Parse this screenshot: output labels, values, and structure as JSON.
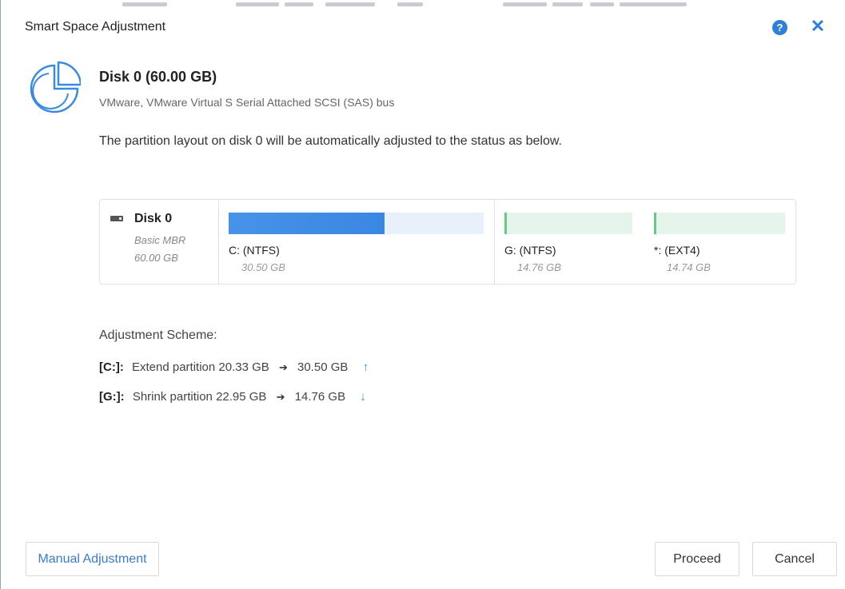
{
  "window": {
    "title": "Smart Space Adjustment",
    "help_icon": "help-icon",
    "close_icon": "close-icon"
  },
  "disk": {
    "icon": "pie-chart-icon",
    "title": "Disk 0 (60.00 GB)",
    "description": "VMware,  VMware Virtual S Serial Attached SCSI (SAS) bus",
    "layout_message": "The partition layout on disk 0 will be automatically adjusted to the status as below."
  },
  "disk_map": {
    "disk_name": "Disk 0",
    "disk_type": "Basic MBR",
    "disk_size": "60.00 GB",
    "partitions": [
      {
        "name": "C: (NTFS)",
        "size": "30.50 GB",
        "used_fraction": 0.61,
        "color": "#3a86e3"
      },
      {
        "name": "G: (NTFS)",
        "size": "14.76 GB",
        "used_fraction": 0.02,
        "color": "#68c888"
      },
      {
        "name": "*: (EXT4)",
        "size": "14.74 GB",
        "used_fraction": 0.02,
        "color": "#68c888"
      }
    ]
  },
  "scheme": {
    "label": "Adjustment Scheme:",
    "rows": [
      {
        "drive": "[C:]:",
        "action": "Extend partition",
        "from": "20.33 GB",
        "arrow": "➔",
        "to": "30.50 GB",
        "direction": "↑"
      },
      {
        "drive": "[G:]:",
        "action": "Shrink partition",
        "from": "22.95 GB",
        "arrow": "➔",
        "to": "14.76 GB",
        "direction": "↓"
      }
    ]
  },
  "buttons": {
    "manual": "Manual Adjustment",
    "proceed": "Proceed",
    "cancel": "Cancel"
  },
  "colors": {
    "accent": "#2f7fd8",
    "primary_bar": "#3a86e3",
    "secondary_bar": "#68c888"
  }
}
